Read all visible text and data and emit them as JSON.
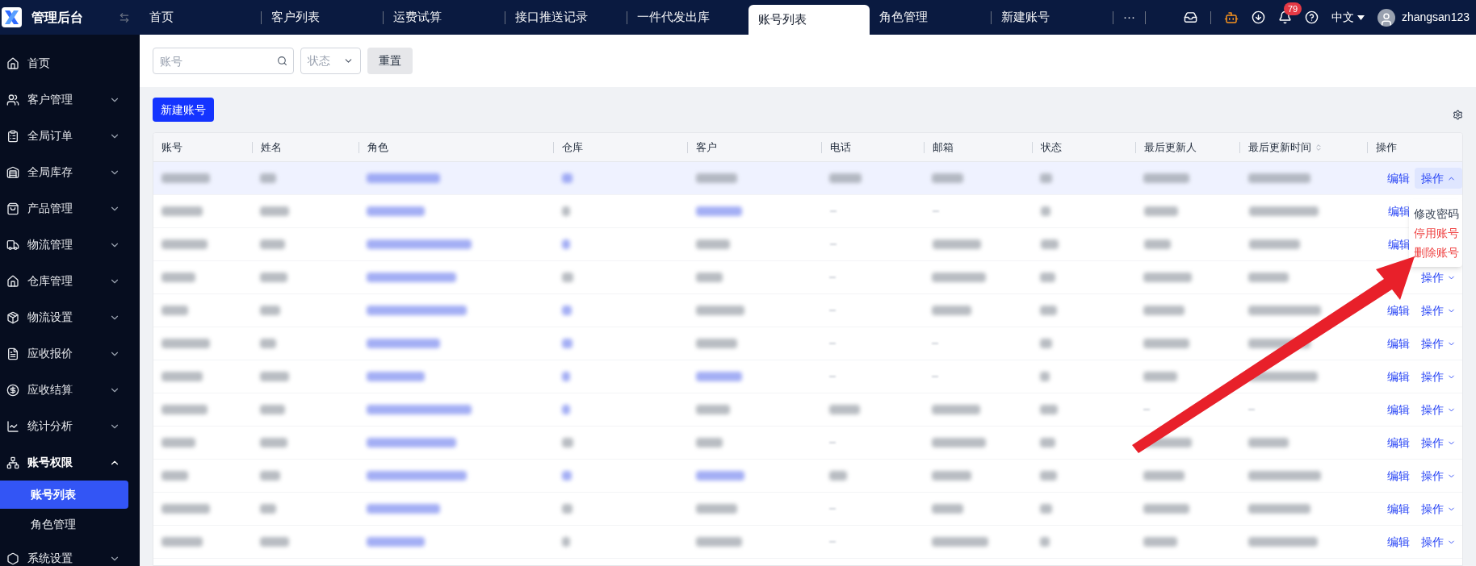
{
  "app": {
    "title": "管理后台"
  },
  "tabs": [
    {
      "label": "首页",
      "selected": false
    },
    {
      "label": "客户列表",
      "selected": false
    },
    {
      "label": "运费试算",
      "selected": false
    },
    {
      "label": "接口推送记录",
      "selected": false
    },
    {
      "label": "一件代发出库",
      "selected": false
    },
    {
      "label": "账号列表",
      "selected": true
    },
    {
      "label": "角色管理",
      "selected": false
    },
    {
      "label": "新建账号",
      "selected": false
    }
  ],
  "more_tabs": "···",
  "header": {
    "notifications": "79",
    "language": "中文",
    "user": "zhangsan123"
  },
  "sidebar": {
    "items": [
      {
        "kind": "home",
        "label": "首页",
        "expanded": false
      },
      {
        "kind": "users",
        "label": "客户管理",
        "expanded": false
      },
      {
        "kind": "orders",
        "label": "全局订单",
        "expanded": false
      },
      {
        "kind": "stock",
        "label": "全局库存",
        "expanded": false
      },
      {
        "kind": "bag",
        "label": "产品管理",
        "expanded": false
      },
      {
        "kind": "truck",
        "label": "物流管理",
        "expanded": false
      },
      {
        "kind": "warehouse",
        "label": "仓库管理",
        "expanded": false
      },
      {
        "kind": "box",
        "label": "物流设置",
        "expanded": false
      },
      {
        "kind": "doc",
        "label": "应收报价",
        "expanded": false
      },
      {
        "kind": "dollar",
        "label": "应收结算",
        "expanded": false
      },
      {
        "kind": "chart",
        "label": "统计分析",
        "expanded": false
      },
      {
        "kind": "tree",
        "label": "账号权限",
        "expanded": true,
        "children": [
          {
            "label": "账号列表",
            "selected": true
          },
          {
            "label": "角色管理",
            "selected": false
          }
        ]
      },
      {
        "kind": "hex",
        "label": "系统设置",
        "expanded": false
      }
    ]
  },
  "filters": {
    "account": {
      "placeholder": "账号"
    },
    "status": {
      "placeholder": "状态"
    },
    "reset": "重置"
  },
  "new_button": "新建账号",
  "table": {
    "columns": [
      {
        "label": "账号",
        "sortable": false
      },
      {
        "label": "姓名",
        "sortable": false
      },
      {
        "label": "角色",
        "sortable": false
      },
      {
        "label": "仓库",
        "sortable": false
      },
      {
        "label": "客户",
        "sortable": false
      },
      {
        "label": "电话",
        "sortable": false
      },
      {
        "label": "邮箱",
        "sortable": false
      },
      {
        "label": "状态",
        "sortable": false
      },
      {
        "label": "最后更新人",
        "sortable": false
      },
      {
        "label": "最后更新时间",
        "sortable": true
      },
      {
        "label": "操作",
        "sortable": false
      }
    ],
    "rows": [
      {
        "cells": [
          {
            "kind": "text"
          },
          {
            "kind": "text"
          },
          {
            "kind": "link"
          },
          {
            "kind": "link"
          },
          {
            "kind": "text"
          },
          {
            "kind": "text"
          },
          {
            "kind": "text"
          },
          {
            "kind": "text"
          },
          {
            "kind": "text"
          },
          {
            "kind": "text"
          }
        ],
        "edit": "编辑",
        "action": "操作",
        "expanded": true,
        "selected": true
      },
      {
        "cells": [
          {
            "kind": "text"
          },
          {
            "kind": "text"
          },
          {
            "kind": "link"
          },
          {
            "kind": "text"
          },
          {
            "kind": "link"
          },
          {
            "kind": "dash"
          },
          {
            "kind": "dash"
          },
          {
            "kind": "text"
          },
          {
            "kind": "text"
          },
          {
            "kind": "text"
          }
        ],
        "edit": "编辑",
        "selected": false
      },
      {
        "cells": [
          {
            "kind": "text"
          },
          {
            "kind": "text"
          },
          {
            "kind": "link"
          },
          {
            "kind": "link"
          },
          {
            "kind": "text"
          },
          {
            "kind": "dash"
          },
          {
            "kind": "text"
          },
          {
            "kind": "text"
          },
          {
            "kind": "text"
          },
          {
            "kind": "text"
          }
        ],
        "edit": "编辑",
        "selected": false
      },
      {
        "cells": [
          {
            "kind": "text"
          },
          {
            "kind": "text"
          },
          {
            "kind": "link"
          },
          {
            "kind": "text"
          },
          {
            "kind": "text"
          },
          {
            "kind": "dash"
          },
          {
            "kind": "text"
          },
          {
            "kind": "text"
          },
          {
            "kind": "text"
          },
          {
            "kind": "text"
          }
        ],
        "action": "操作",
        "expanded": false,
        "selected": false
      },
      {
        "cells": [
          {
            "kind": "text"
          },
          {
            "kind": "text"
          },
          {
            "kind": "link"
          },
          {
            "kind": "link"
          },
          {
            "kind": "text"
          },
          {
            "kind": "dash"
          },
          {
            "kind": "text"
          },
          {
            "kind": "text"
          },
          {
            "kind": "text"
          },
          {
            "kind": "text"
          }
        ],
        "edit": "编辑",
        "action": "操作",
        "expanded": false,
        "selected": false
      },
      {
        "cells": [
          {
            "kind": "text"
          },
          {
            "kind": "text"
          },
          {
            "kind": "link"
          },
          {
            "kind": "link"
          },
          {
            "kind": "text"
          },
          {
            "kind": "dash"
          },
          {
            "kind": "dash"
          },
          {
            "kind": "text"
          },
          {
            "kind": "text"
          },
          {
            "kind": "text"
          }
        ],
        "edit": "编辑",
        "action": "操作",
        "expanded": false,
        "selected": false
      },
      {
        "cells": [
          {
            "kind": "text"
          },
          {
            "kind": "text"
          },
          {
            "kind": "link"
          },
          {
            "kind": "link"
          },
          {
            "kind": "link"
          },
          {
            "kind": "dash"
          },
          {
            "kind": "dash"
          },
          {
            "kind": "text"
          },
          {
            "kind": "text"
          },
          {
            "kind": "text"
          }
        ],
        "edit": "编辑",
        "action": "操作",
        "expanded": false,
        "selected": false
      },
      {
        "cells": [
          {
            "kind": "text"
          },
          {
            "kind": "text"
          },
          {
            "kind": "link"
          },
          {
            "kind": "link"
          },
          {
            "kind": "text"
          },
          {
            "kind": "text"
          },
          {
            "kind": "text"
          },
          {
            "kind": "text"
          },
          {
            "kind": "dash"
          },
          {
            "kind": "dash"
          }
        ],
        "edit": "编辑",
        "action": "操作",
        "expanded": false,
        "selected": false
      },
      {
        "cells": [
          {
            "kind": "text"
          },
          {
            "kind": "text"
          },
          {
            "kind": "link"
          },
          {
            "kind": "text"
          },
          {
            "kind": "text"
          },
          {
            "kind": "dash"
          },
          {
            "kind": "text"
          },
          {
            "kind": "text"
          },
          {
            "kind": "text"
          },
          {
            "kind": "text"
          }
        ],
        "edit": "编辑",
        "action": "操作",
        "expanded": false,
        "selected": false
      },
      {
        "cells": [
          {
            "kind": "text"
          },
          {
            "kind": "text"
          },
          {
            "kind": "link"
          },
          {
            "kind": "link"
          },
          {
            "kind": "link"
          },
          {
            "kind": "text"
          },
          {
            "kind": "text"
          },
          {
            "kind": "text"
          },
          {
            "kind": "text"
          },
          {
            "kind": "text"
          }
        ],
        "edit": "编辑",
        "action": "操作",
        "expanded": false,
        "selected": false
      },
      {
        "cells": [
          {
            "kind": "text"
          },
          {
            "kind": "text"
          },
          {
            "kind": "link"
          },
          {
            "kind": "text"
          },
          {
            "kind": "text"
          },
          {
            "kind": "dash"
          },
          {
            "kind": "text"
          },
          {
            "kind": "text"
          },
          {
            "kind": "text"
          },
          {
            "kind": "text"
          }
        ],
        "edit": "编辑",
        "action": "操作",
        "expanded": false,
        "selected": false
      },
      {
        "cells": [
          {
            "kind": "text"
          },
          {
            "kind": "text"
          },
          {
            "kind": "link"
          },
          {
            "kind": "text"
          },
          {
            "kind": "text"
          },
          {
            "kind": "dash"
          },
          {
            "kind": "text"
          },
          {
            "kind": "text"
          },
          {
            "kind": "text"
          },
          {
            "kind": "text"
          }
        ],
        "edit": "编辑",
        "action": "操作",
        "expanded": false,
        "selected": false
      }
    ]
  },
  "action_menu": [
    {
      "label": "修改密码",
      "kind": "normal"
    },
    {
      "label": "停用账号",
      "kind": "danger"
    },
    {
      "label": "删除账号",
      "kind": "danger"
    }
  ],
  "annotation": {
    "kind": "arrow"
  }
}
